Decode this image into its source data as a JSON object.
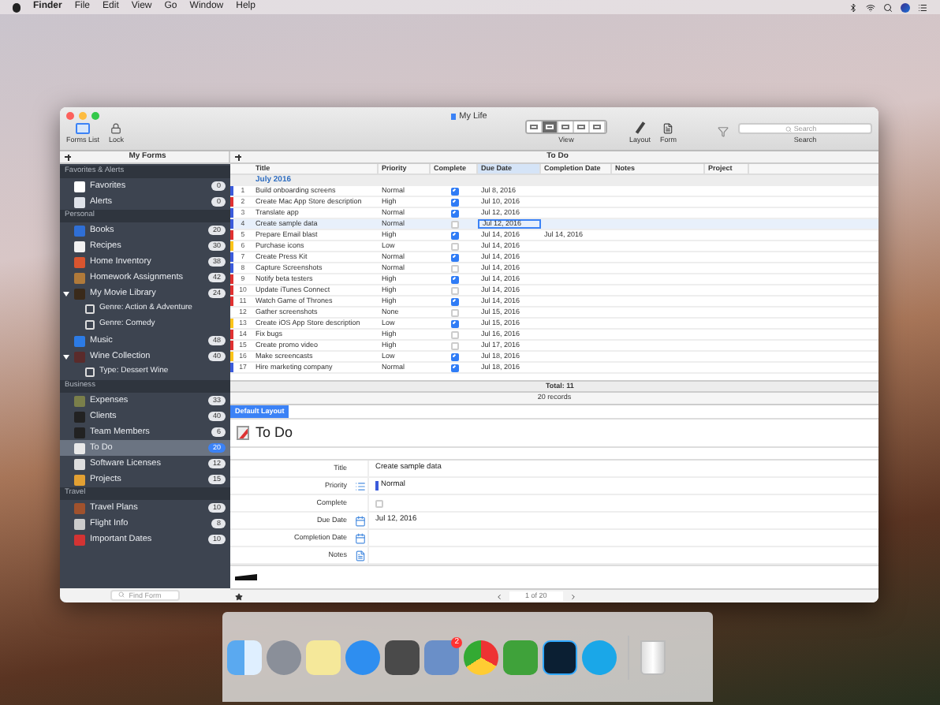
{
  "menu_bar": {
    "items": [
      "Finder",
      "File",
      "Edit",
      "View",
      "Go",
      "Window",
      "Help"
    ]
  },
  "window": {
    "title": "My Life"
  },
  "toolbar": {
    "forms_list": "Forms List",
    "lock": "Lock",
    "view_label": "View",
    "view_segments": [
      {
        "selected": false
      },
      {
        "selected": true
      },
      {
        "selected": false
      },
      {
        "selected": false
      },
      {
        "selected": false
      }
    ],
    "layout": "Layout",
    "form": "Form",
    "search_placeholder": "Search",
    "search_label": "Search"
  },
  "sidebar": {
    "header": "My Forms",
    "sections": [
      {
        "title": "Favorites & Alerts",
        "items": [
          {
            "label": "Favorites",
            "count": "0",
            "selected": false
          },
          {
            "label": "Alerts",
            "count": "0",
            "selected": false
          }
        ]
      },
      {
        "title": "Personal",
        "items": [
          {
            "label": "Books",
            "count": "20",
            "selected": false
          },
          {
            "label": "Recipes",
            "count": "30",
            "selected": false
          },
          {
            "label": "Home Inventory",
            "count": "38",
            "selected": false
          },
          {
            "label": "Homework Assignments",
            "count": "42",
            "selected": false
          },
          {
            "label": "My Movie Library",
            "count": "24",
            "selected": false,
            "expanded": true,
            "children": [
              {
                "label": "Genre: Action & Adventure"
              },
              {
                "label": "Genre: Comedy"
              }
            ]
          },
          {
            "label": "Music",
            "count": "48",
            "selected": false
          },
          {
            "label": "Wine Collection",
            "count": "40",
            "selected": false,
            "expanded": true,
            "children": [
              {
                "label": "Type: Dessert Wine"
              }
            ]
          }
        ]
      },
      {
        "title": "Business",
        "items": [
          {
            "label": "Expenses",
            "count": "33",
            "selected": false
          },
          {
            "label": "Clients",
            "count": "40",
            "selected": false
          },
          {
            "label": "Team Members",
            "count": "6",
            "selected": false
          },
          {
            "label": "To Do",
            "count": "20",
            "selected": true
          },
          {
            "label": "Software Licenses",
            "count": "12",
            "selected": false
          },
          {
            "label": "Projects",
            "count": "15",
            "selected": false
          }
        ]
      },
      {
        "title": "Travel",
        "items": [
          {
            "label": "Travel Plans",
            "count": "10",
            "selected": false
          },
          {
            "label": "Flight Info",
            "count": "8",
            "selected": false
          },
          {
            "label": "Important Dates",
            "count": "10",
            "selected": false
          }
        ]
      }
    ],
    "search_placeholder": "Find Form"
  },
  "table": {
    "form_title": "To Do",
    "columns": [
      {
        "label": "Title",
        "selected": false
      },
      {
        "label": "Priority",
        "selected": false
      },
      {
        "label": "Complete",
        "selected": false
      },
      {
        "label": "Due Date",
        "selected": true
      },
      {
        "label": "Completion Date",
        "selected": false
      },
      {
        "label": "Notes",
        "selected": false
      },
      {
        "label": "Project",
        "selected": false
      }
    ],
    "group": "July 2016",
    "rows": [
      {
        "number": "1",
        "title": "Build onboarding screens",
        "priority": "Normal",
        "complete": true,
        "due_date": "Jul 8, 2016",
        "color": "#3b5bdb",
        "selected": false
      },
      {
        "number": "2",
        "title": "Create Mac App Store description",
        "priority": "High",
        "complete": true,
        "due_date": "Jul 10, 2016",
        "color": "#e03131",
        "selected": false
      },
      {
        "number": "3",
        "title": "Translate app",
        "priority": "Normal",
        "complete": true,
        "due_date": "Jul 12, 2016",
        "color": "#3b5bdb",
        "selected": false
      },
      {
        "number": "4",
        "title": "Create sample data",
        "priority": "Normal",
        "complete": false,
        "due_date": "Jul 12, 2016",
        "color": "#3b5bdb",
        "selected": true
      },
      {
        "number": "5",
        "title": "Prepare Email blast",
        "priority": "High",
        "complete": true,
        "due_date": "Jul 14, 2016",
        "completion_date": "Jul 14, 2016",
        "color": "#e03131",
        "selected": false
      },
      {
        "number": "6",
        "title": "Purchase icons",
        "priority": "Low",
        "complete": false,
        "due_date": "Jul 14, 2016",
        "color": "#fcc419",
        "selected": false
      },
      {
        "number": "7",
        "title": "Create Press Kit",
        "priority": "Normal",
        "complete": true,
        "due_date": "Jul 14, 2016",
        "color": "#3b5bdb",
        "selected": false
      },
      {
        "number": "8",
        "title": "Capture Screenshots",
        "priority": "Normal",
        "complete": false,
        "due_date": "Jul 14, 2016",
        "color": "#3b5bdb",
        "selected": false
      },
      {
        "number": "9",
        "title": "Notify beta testers",
        "priority": "High",
        "complete": true,
        "due_date": "Jul 14, 2016",
        "color": "#e03131",
        "selected": false
      },
      {
        "number": "10",
        "title": "Update iTunes Connect",
        "priority": "High",
        "complete": false,
        "due_date": "Jul 14, 2016",
        "color": "#e03131",
        "selected": false
      },
      {
        "number": "11",
        "title": "Watch Game of Thrones",
        "priority": "High",
        "complete": true,
        "due_date": "Jul 14, 2016",
        "color": "#e03131",
        "selected": false
      },
      {
        "number": "12",
        "title": "Gather screenshots",
        "priority": "None",
        "complete": false,
        "due_date": "Jul 15, 2016",
        "selected": false
      },
      {
        "number": "13",
        "title": "Create iOS App Store description",
        "priority": "Low",
        "complete": true,
        "due_date": "Jul 15, 2016",
        "color": "#fcc419",
        "selected": false
      },
      {
        "number": "14",
        "title": "Fix bugs",
        "priority": "High",
        "complete": false,
        "due_date": "Jul 16, 2016",
        "color": "#e03131",
        "selected": false
      },
      {
        "number": "15",
        "title": "Create promo video",
        "priority": "High",
        "complete": false,
        "due_date": "Jul 17, 2016",
        "color": "#e03131",
        "selected": false
      },
      {
        "number": "16",
        "title": "Make screencasts",
        "priority": "Low",
        "complete": true,
        "due_date": "Jul 18, 2016",
        "color": "#fcc419",
        "selected": false
      },
      {
        "number": "17",
        "title": "Hire marketing company",
        "priority": "Normal",
        "complete": true,
        "due_date": "Jul 18, 2016",
        "color": "#3b5bdb",
        "selected": false
      }
    ],
    "total": "Total: 11",
    "records": "20 records"
  },
  "detail": {
    "layout_tab": {
      "label": "Default Layout",
      "selected": true
    },
    "form_title": "To Do",
    "fields": [
      {
        "label": "Title",
        "kind": "text",
        "value": "Create sample data"
      },
      {
        "label": "Priority",
        "kind": "choice",
        "value": "Normal"
      },
      {
        "label": "Complete",
        "kind": "checkbox",
        "checked": false
      },
      {
        "label": "Due Date",
        "kind": "date",
        "value": "Jul 12, 2016"
      },
      {
        "label": "Completion Date",
        "kind": "date"
      },
      {
        "label": "Notes",
        "kind": "note"
      }
    ],
    "pager": "1 of 20"
  },
  "dock": {
    "badge": "2"
  }
}
